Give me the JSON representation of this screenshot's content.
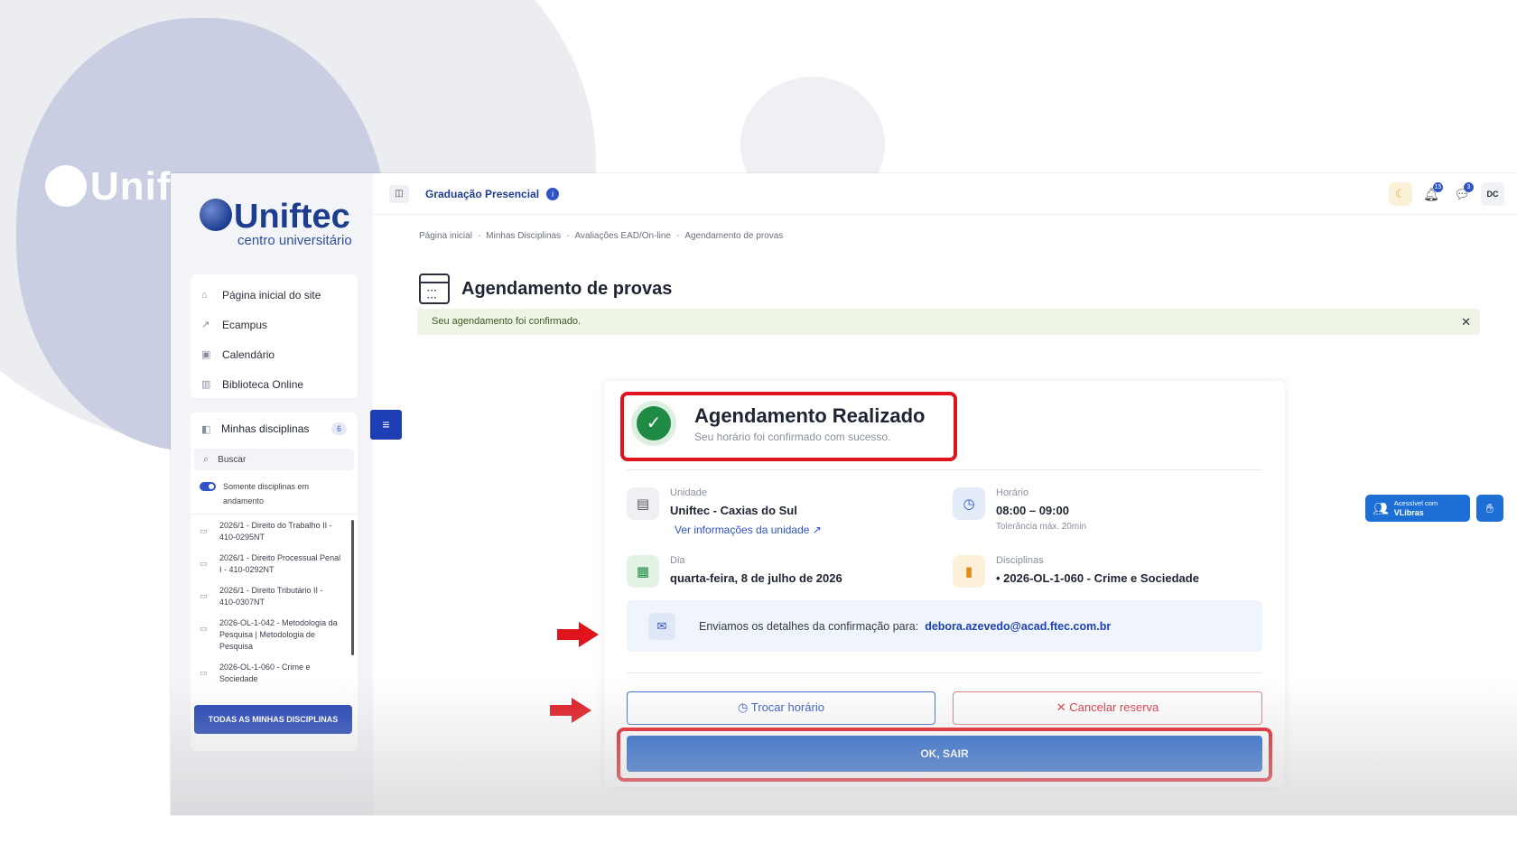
{
  "background": {
    "brand_text": "Unif"
  },
  "logo": {
    "name": "Uniftec",
    "subtitle": "centro universitário"
  },
  "sidebar": {
    "nav": [
      {
        "label": "Página inicial do site",
        "icon": "home-icon"
      },
      {
        "label": "Ecampus",
        "icon": "external-link-icon"
      },
      {
        "label": "Calendário",
        "icon": "calendar-icon"
      },
      {
        "label": "Biblioteca Online",
        "icon": "library-icon"
      }
    ],
    "disciplines": {
      "title": "Minhas disciplinas",
      "count": "6",
      "search_placeholder": "Buscar",
      "toggle_label": "Somente disciplinas em andamento",
      "items": [
        "2026/1 - Direito do Trabalho II - 410-0295NT",
        "2026/1 - Direito Processual Penal I - 410-0292NT",
        "2026/1 - Direito Tributário II - 410-0307NT",
        "2026-OL-1-042 - Metodologia da Pesquisa | Metodologia de Pesquisa",
        "2026-OL-1-060 - Crime e Sociedade"
      ],
      "all_button": "TODAS AS MINHAS DISCIPLINAS"
    }
  },
  "topbar": {
    "title": "Graduação Presencial",
    "notifications_count": "15",
    "messages_count": "3",
    "user_initials": "DC"
  },
  "breadcrumb": [
    "Página inicial",
    "Minhas Disciplinas",
    "Avaliações EAD/On-line",
    "Agendamento de provas"
  ],
  "page": {
    "title": "Agendamento de provas",
    "alert": "Seu agendamento foi confirmado."
  },
  "confirmation": {
    "title": "Agendamento Realizado",
    "subtitle": "Seu horário foi confirmado com sucesso.",
    "unit_label": "Unidade",
    "unit_value": "Uniftec - Caxias do Sul",
    "unit_link": "Ver informações da unidade",
    "time_label": "Horário",
    "time_value": "08:00 – 09:00",
    "time_note": "Tolerância máx. 20min",
    "day_label": "Dia",
    "day_value": "quarta-feira, 8 de julho de 2026",
    "disc_label": "Disciplinas",
    "disc_value": "• 2026-OL-1-060 - Crime e Sociedade",
    "email_text": "Enviamos os detalhes da confirmação para:",
    "email_address": "debora.azevedo@acad.ftec.com.br",
    "swap_button": "Trocar horário",
    "cancel_button": "Cancelar reserva",
    "ok_button": "OK, SAIR"
  },
  "vlibras": {
    "line1": "Acessível com",
    "line2": "VLibras"
  },
  "colors": {
    "brand": "#1d3d8f",
    "primary_button": "#1d5fc6",
    "success": "#1e8a44",
    "highlight": "#e0141c"
  }
}
